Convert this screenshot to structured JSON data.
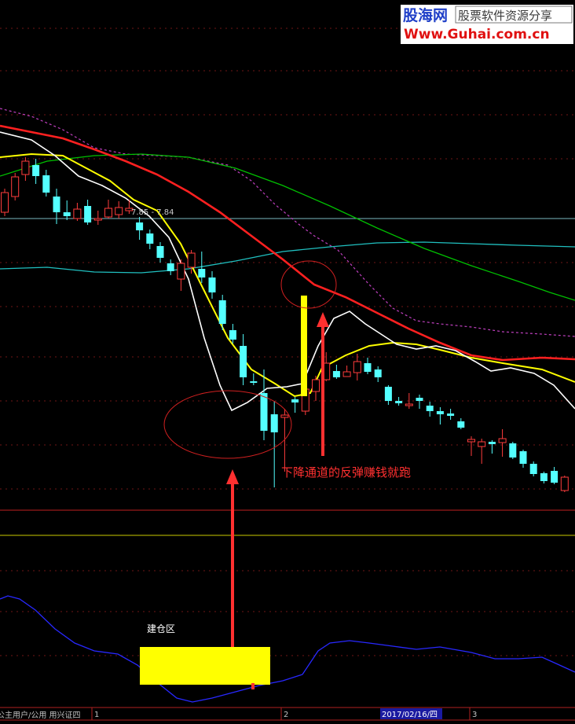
{
  "watermark": {
    "brand": "股海网",
    "tagline": "股票软件资源分享",
    "url": "Www.Guhai.com.cn"
  },
  "annotations": {
    "price_label": "7.85 - 7.84",
    "rebound_note": "下降通道的反弹赚钱就跑",
    "build_zone": "建仓区"
  },
  "footer": {
    "left_text": "公主用户/公用 用兴证四",
    "ticks": [
      "1",
      "2",
      "2017/02/16/四",
      "3"
    ]
  },
  "colors": {
    "up": "#ff3c3c",
    "down": "#54ffff",
    "ma5": "#ffffff",
    "ma10": "#ffff00",
    "ma20": "#ff2020",
    "ma60": "#00c000",
    "ma120": "#20c0c0",
    "dashed": "#c040c0",
    "indicator": "#2020ff",
    "arrow": "#ff3030",
    "highlight": "#ffff00"
  },
  "chart_data": {
    "type": "candlestick",
    "candles": [
      {
        "o": 120,
        "c": 95,
        "h": 90,
        "l": 125,
        "col": "up"
      },
      {
        "o": 100,
        "c": 75,
        "h": 70,
        "l": 105,
        "col": "up"
      },
      {
        "o": 72,
        "c": 55,
        "h": 50,
        "l": 80,
        "col": "up"
      },
      {
        "o": 60,
        "c": 74,
        "h": 52,
        "l": 84,
        "col": "down"
      },
      {
        "o": 73,
        "c": 95,
        "h": 66,
        "l": 100,
        "col": "down"
      },
      {
        "o": 100,
        "c": 120,
        "h": 90,
        "l": 135,
        "col": "down"
      },
      {
        "o": 120,
        "c": 125,
        "h": 105,
        "l": 130,
        "col": "down"
      },
      {
        "o": 116,
        "c": 128,
        "h": 108,
        "l": 131,
        "col": "up"
      },
      {
        "o": 112,
        "c": 133,
        "h": 104,
        "l": 136,
        "col": "down"
      },
      {
        "o": 130,
        "c": 128,
        "h": 118,
        "l": 136,
        "col": "up"
      },
      {
        "o": 126,
        "c": 115,
        "h": 104,
        "l": 128,
        "col": "up"
      },
      {
        "o": 114,
        "c": 123,
        "h": 106,
        "l": 128,
        "col": "up"
      },
      {
        "o": 118,
        "c": 115,
        "h": 104,
        "l": 122,
        "col": "up"
      },
      {
        "o": 133,
        "c": 143,
        "h": 126,
        "l": 155,
        "col": "down"
      },
      {
        "o": 147,
        "c": 160,
        "h": 142,
        "l": 167,
        "col": "down"
      },
      {
        "o": 163,
        "c": 178,
        "h": 158,
        "l": 184,
        "col": "down"
      },
      {
        "o": 185,
        "c": 195,
        "h": 180,
        "l": 200,
        "col": "down"
      },
      {
        "o": 205,
        "c": 185,
        "h": 180,
        "l": 220,
        "col": "up"
      },
      {
        "o": 190,
        "c": 172,
        "h": 168,
        "l": 198,
        "col": "up"
      },
      {
        "o": 192,
        "c": 203,
        "h": 170,
        "l": 210,
        "col": "down"
      },
      {
        "o": 203,
        "c": 222,
        "h": 195,
        "l": 230,
        "col": "down"
      },
      {
        "o": 232,
        "c": 262,
        "h": 225,
        "l": 270,
        "col": "down"
      },
      {
        "o": 270,
        "c": 282,
        "h": 262,
        "l": 287,
        "col": "down"
      },
      {
        "o": 290,
        "c": 330,
        "h": 275,
        "l": 340,
        "col": "down"
      },
      {
        "o": 335,
        "c": 335,
        "h": 325,
        "l": 340,
        "col": "down"
      },
      {
        "o": 350,
        "c": 398,
        "h": 320,
        "l": 410,
        "col": "down"
      },
      {
        "o": 400,
        "c": 377,
        "h": 360,
        "l": 470,
        "col": "down"
      },
      {
        "o": 381,
        "c": 378,
        "h": 370,
        "l": 450,
        "col": "up"
      },
      {
        "o": 358,
        "c": 362,
        "h": 355,
        "l": 375,
        "col": "down"
      },
      {
        "o": 373,
        "c": 345,
        "h": 338,
        "l": 378,
        "col": "up"
      },
      {
        "o": 348,
        "c": 333,
        "h": 328,
        "l": 360,
        "col": "up"
      },
      {
        "o": 333,
        "c": 312,
        "h": 298,
        "l": 335,
        "col": "up"
      },
      {
        "o": 322,
        "c": 330,
        "h": 314,
        "l": 332,
        "col": "down"
      },
      {
        "o": 329,
        "c": 323,
        "h": 315,
        "l": 328,
        "col": "up"
      },
      {
        "o": 324,
        "c": 310,
        "h": 300,
        "l": 334,
        "col": "up"
      },
      {
        "o": 312,
        "c": 323,
        "h": 305,
        "l": 326,
        "col": "down"
      },
      {
        "o": 320,
        "c": 330,
        "h": 316,
        "l": 336,
        "col": "down"
      },
      {
        "o": 342,
        "c": 360,
        "h": 340,
        "l": 365,
        "col": "down"
      },
      {
        "o": 360,
        "c": 363,
        "h": 355,
        "l": 366,
        "col": "down"
      },
      {
        "o": 364,
        "c": 365,
        "h": 350,
        "l": 370,
        "col": "up"
      },
      {
        "o": 356,
        "c": 360,
        "h": 352,
        "l": 370,
        "col": "down"
      },
      {
        "o": 366,
        "c": 373,
        "h": 361,
        "l": 380,
        "col": "down"
      },
      {
        "o": 373,
        "c": 377,
        "h": 368,
        "l": 390,
        "col": "down"
      },
      {
        "o": 376,
        "c": 379,
        "h": 370,
        "l": 384,
        "col": "down"
      },
      {
        "o": 386,
        "c": 394,
        "h": 382,
        "l": 396,
        "col": "down"
      },
      {
        "o": 409,
        "c": 412,
        "h": 405,
        "l": 430,
        "col": "up"
      },
      {
        "o": 418,
        "c": 412,
        "h": 408,
        "l": 440,
        "col": "up"
      },
      {
        "o": 412,
        "c": 415,
        "h": 410,
        "l": 427,
        "col": "down"
      },
      {
        "o": 413,
        "c": 408,
        "h": 396,
        "l": 431,
        "col": "up"
      },
      {
        "o": 414,
        "c": 432,
        "h": 412,
        "l": 434,
        "col": "down"
      },
      {
        "o": 424,
        "c": 440,
        "h": 422,
        "l": 445,
        "col": "down"
      },
      {
        "o": 440,
        "c": 453,
        "h": 437,
        "l": 456,
        "col": "down"
      },
      {
        "o": 452,
        "c": 462,
        "h": 450,
        "l": 465,
        "col": "down"
      },
      {
        "o": 449,
        "c": 464,
        "h": 444,
        "l": 466,
        "col": "down"
      },
      {
        "o": 474,
        "c": 457,
        "h": 455,
        "l": 476,
        "col": "up"
      }
    ]
  }
}
